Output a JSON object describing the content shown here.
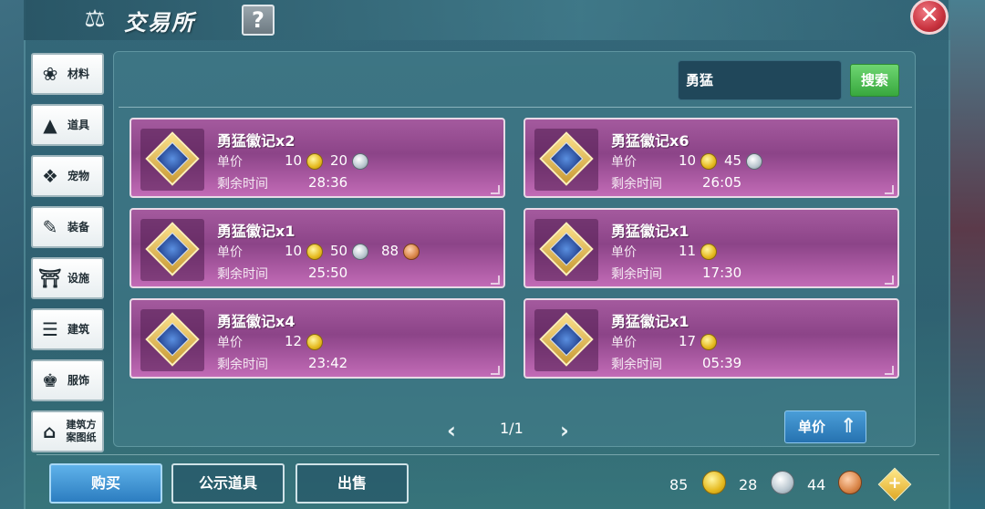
{
  "window": {
    "title": "交易所",
    "help_label": "?",
    "close_label": "✕",
    "title_icon": "scale-icon"
  },
  "sidebar": {
    "items": [
      {
        "label": "材料",
        "icon": "material-icon",
        "glyph": "❀"
      },
      {
        "label": "道具",
        "icon": "item-icon",
        "glyph": "▲"
      },
      {
        "label": "宠物",
        "icon": "pet-paw-icon",
        "glyph": "❖"
      },
      {
        "label": "装备",
        "icon": "equipment-icon",
        "glyph": "✎"
      },
      {
        "label": "设施",
        "icon": "facility-icon",
        "glyph": "⛩"
      },
      {
        "label": "建筑",
        "icon": "building-icon",
        "glyph": "☰"
      },
      {
        "label": "服饰",
        "icon": "clothing-icon",
        "glyph": "♚"
      },
      {
        "label": "建筑方案图纸",
        "icon": "blueprint-icon",
        "glyph": "⌂"
      }
    ]
  },
  "search": {
    "value": "勇猛",
    "button_label": "搜索"
  },
  "labels": {
    "unit_price": "单价",
    "remaining_time": "剩余时间"
  },
  "listings": [
    {
      "name": "勇猛徽记x2",
      "gold": "10",
      "silver": "20",
      "copper": null,
      "time": "28:36"
    },
    {
      "name": "勇猛徽记x6",
      "gold": "10",
      "silver": "45",
      "copper": null,
      "time": "26:05"
    },
    {
      "name": "勇猛徽记x1",
      "gold": "10",
      "silver": "50",
      "copper": "88",
      "time": "25:50"
    },
    {
      "name": "勇猛徽记x1",
      "gold": "11",
      "silver": null,
      "copper": null,
      "time": "17:30"
    },
    {
      "name": "勇猛徽记x4",
      "gold": "12",
      "silver": null,
      "copper": null,
      "time": "23:42"
    },
    {
      "name": "勇猛徽记x1",
      "gold": "17",
      "silver": null,
      "copper": null,
      "time": "05:39"
    }
  ],
  "pagination": {
    "prev": "‹",
    "next": "›",
    "text": "1/1"
  },
  "sort": {
    "label": "单价",
    "icon": "sort-up-icon"
  },
  "bottom": {
    "buy_label": "购买",
    "public_label": "公示道具",
    "sell_label": "出售"
  },
  "currency": {
    "gold": "85",
    "silver": "28",
    "copper": "44",
    "add_label": "+"
  },
  "colors": {
    "card": "#a45a9e",
    "search_button": "#38a83e",
    "buy_button": "#2c7dc0",
    "close_button": "#c8323e"
  }
}
